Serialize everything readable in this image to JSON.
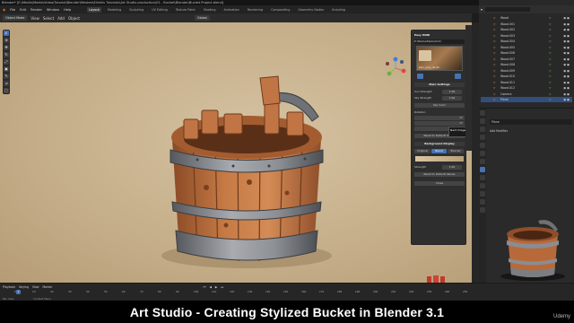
{
  "titlebar": {
    "text": "Blender* [E:\\Media\\Media\\Video\\Tutorial\\Blender\\Meshes\\Elinikis Tutorials\\Art Studio production\\01 - Bucket\\Blender\\Bucket Project.blend]"
  },
  "menubar": {
    "items": [
      "File",
      "Edit",
      "Render",
      "Window",
      "Help"
    ],
    "workspaces": [
      "Layout",
      "Modeling",
      "Sculpting",
      "UV Editing",
      "Texture Paint",
      "Shading",
      "Animation",
      "Rendering",
      "Compositing",
      "Geometry Nodes",
      "Scripting"
    ],
    "active_workspace": "Layout",
    "scene_label": "Scene",
    "view_layer_label": "ViewLayer"
  },
  "headerbar": {
    "mode": "Object Mode",
    "menus": [
      "View",
      "Select",
      "Add",
      "Object"
    ],
    "orientation": "Global"
  },
  "npanel": {
    "title": "Easy HDRI",
    "path_label": "E:\\Media\\Media\\hdri",
    "thumbnail_caption": "barn_ivory_4k.hdr",
    "section1": "Main Settings",
    "sun_strength_label": "Sun Strength",
    "sun_strength_value": "1.00",
    "sky_strength_label": "Sky Strength",
    "sky_strength_value": "1.00",
    "sky_color": "Sky Color",
    "rotation_label": "Rotation",
    "rotation_x": "0°",
    "rotation_y": "0°",
    "rotation_z": "0°",
    "reset_label": "Reset to Default Values",
    "section2": "Background Display",
    "bg_modes": [
      "Original",
      "Blend",
      "Blurred"
    ],
    "active_bg_mode": "Blend",
    "strength_label": "Strength",
    "strength_value": "1.00",
    "reset_label_2": "Reset to Default Values",
    "close_label": "Close"
  },
  "tooltip": {
    "text": "Next Image"
  },
  "outliner": {
    "rows": [
      {
        "name": "Wood",
        "selected": false
      },
      {
        "name": "Wood.001",
        "selected": false
      },
      {
        "name": "Wood.002",
        "selected": false
      },
      {
        "name": "Wood.003",
        "selected": false
      },
      {
        "name": "Wood.004",
        "selected": false
      },
      {
        "name": "Wood.005",
        "selected": false
      },
      {
        "name": "Wood.006",
        "selected": false
      },
      {
        "name": "Wood.007",
        "selected": false
      },
      {
        "name": "Wood.008",
        "selected": false
      },
      {
        "name": "Wood.009",
        "selected": false
      },
      {
        "name": "Wood.010",
        "selected": false
      },
      {
        "name": "Wood.011",
        "selected": false
      },
      {
        "name": "Wood.012",
        "selected": false
      },
      {
        "name": "Camera",
        "selected": false
      },
      {
        "name": "Plane",
        "selected": true
      }
    ]
  },
  "properties": {
    "object_name": "Plane",
    "add_modifier": "Add Modifier"
  },
  "timeline": {
    "menus": [
      "Playback",
      "Keying",
      "View",
      "Marker"
    ],
    "frames": [
      "0",
      "10",
      "20",
      "30",
      "40",
      "50",
      "60",
      "70",
      "80",
      "90",
      "100",
      "110",
      "120",
      "130",
      "140",
      "150",
      "160",
      "170",
      "180",
      "190",
      "200",
      "210",
      "220",
      "230",
      "240",
      "250"
    ],
    "current_frame": "1",
    "status": [
      "Pan View",
      "Context Menu"
    ]
  },
  "caption": {
    "text": "Art Studio - Creating Stylized Bucket in Blender 3.1",
    "watermark": "Udemy"
  },
  "colors": {
    "accent": "#4772b3",
    "viewport_bg": "#c9b28d",
    "wood": "#b8693a",
    "metal": "#8a8d92"
  }
}
